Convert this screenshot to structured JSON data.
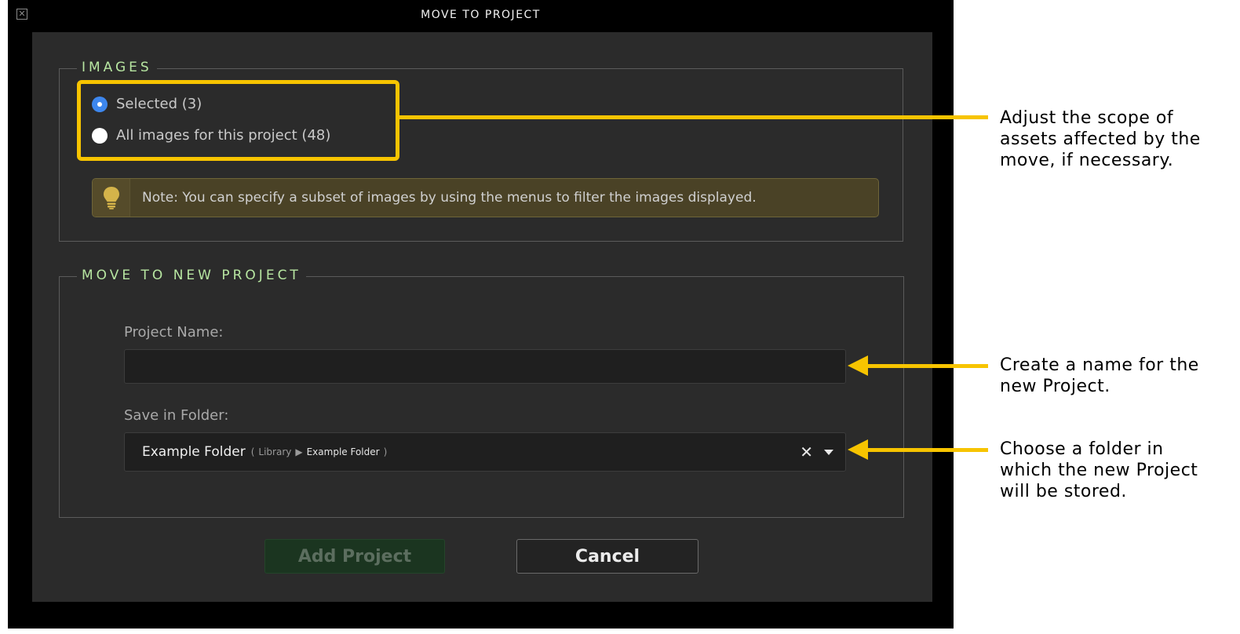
{
  "dialog": {
    "title": "MOVE TO PROJECT",
    "close_icon": "close-box-icon",
    "close_glyph": "✕"
  },
  "images_section": {
    "legend": "IMAGES",
    "options": [
      {
        "label": "Selected (3)",
        "selected": true
      },
      {
        "label": "All images for this project (48)",
        "selected": false
      }
    ],
    "note": {
      "icon": "lightbulb-icon",
      "text": "Note: You can specify a subset of images by using the menus to filter the images displayed."
    }
  },
  "new_project_section": {
    "legend": "MOVE TO NEW PROJECT",
    "project_name": {
      "label": "Project Name:",
      "value": ""
    },
    "save_in_folder": {
      "label": "Save in Folder:",
      "value": "Example Folder",
      "path_open": "(",
      "path_root": "Library",
      "path_separator": "▶",
      "path_leaf": "Example Folder",
      "path_close": ")",
      "clear_glyph": "✕"
    }
  },
  "buttons": {
    "add_project": "Add Project",
    "cancel": "Cancel"
  },
  "annotations": {
    "scope": [
      "Adjust the scope of",
      "assets affected by the",
      "move, if necessary."
    ],
    "name": [
      "Create a name for the",
      "new Project."
    ],
    "folder": [
      "Choose a folder in",
      "which the new Project",
      "will be stored."
    ]
  },
  "colors": {
    "accent_highlight": "#f7c400",
    "legend_text": "#b7e6a1",
    "radio_selected": "#3d87ee",
    "note_background": "#4a4226"
  }
}
